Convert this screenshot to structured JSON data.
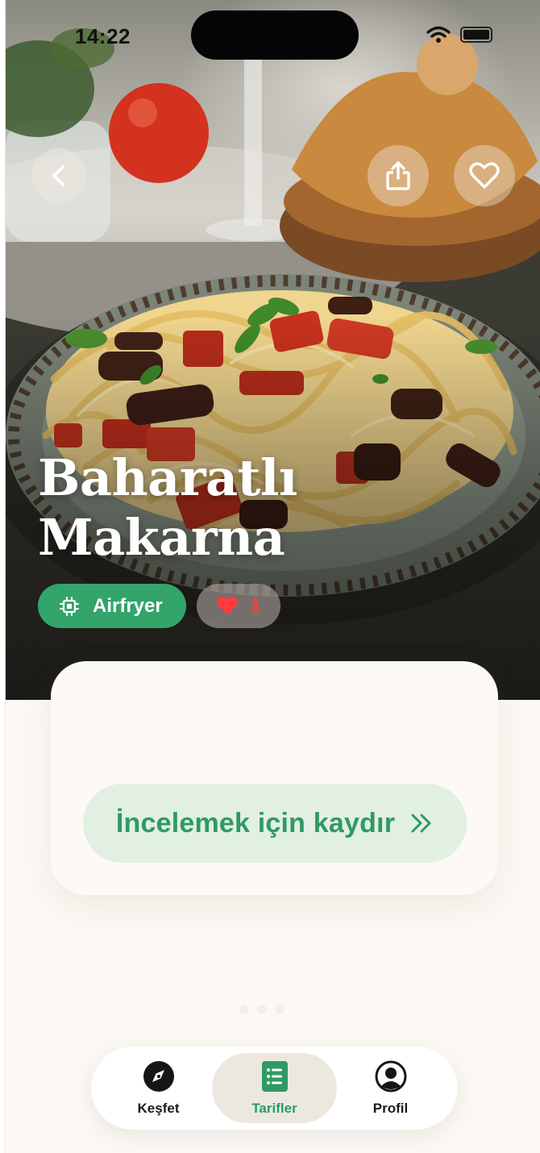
{
  "status_bar": {
    "time": "14:22"
  },
  "recipe": {
    "title_line1": "Baharatlı",
    "title_line2": "Makarna",
    "tag_label": "Airfryer",
    "like_count": "1"
  },
  "card": {
    "swipe_label": "İncelemek için kaydır"
  },
  "tab_bar": {
    "items": [
      {
        "label": "Keşfet",
        "icon": "compass-icon"
      },
      {
        "label": "Tarifler",
        "icon": "recipe-list-icon"
      },
      {
        "label": "Profil",
        "icon": "person-icon"
      }
    ],
    "active": "Tarifler"
  },
  "colors": {
    "accent_green": "#33a46a",
    "pill_bg": "#e2efe3",
    "background": "#fcf8f3",
    "heart_red": "#ff3b3b"
  }
}
